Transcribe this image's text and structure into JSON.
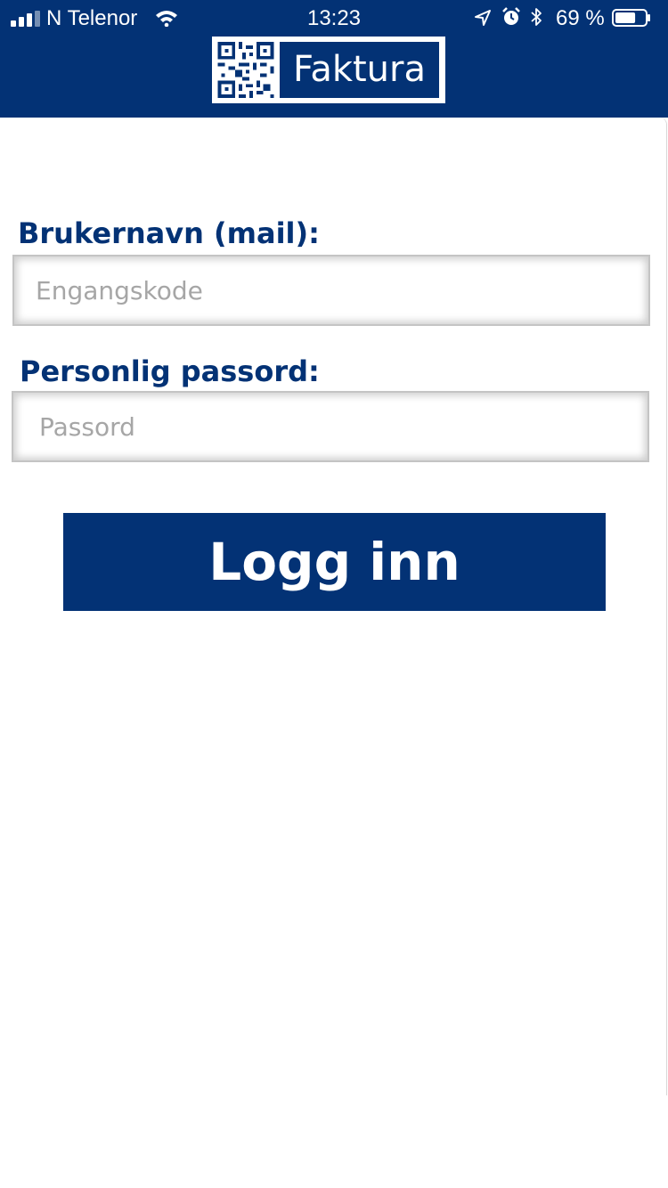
{
  "status_bar": {
    "carrier": "N Telenor",
    "time": "13:23",
    "battery_percent": "69 %",
    "battery_level": 0.69,
    "icons": [
      "signal-icon",
      "wifi-icon",
      "location-icon",
      "alarm-icon",
      "bluetooth-icon",
      "battery-icon"
    ]
  },
  "header": {
    "logo_text": "Faktura",
    "logo_icon": "qr-code-icon"
  },
  "form": {
    "username_label": "Brukernavn (mail):",
    "username_placeholder": "Engangskode",
    "username_value": "",
    "password_label": "Personlig passord:",
    "password_placeholder": "Passord",
    "password_value": "",
    "login_button": "Logg inn"
  },
  "colors": {
    "brand": "#033275",
    "background": "#ffffff",
    "placeholder": "#a6a6a6",
    "field_border": "#c4c4c4"
  }
}
